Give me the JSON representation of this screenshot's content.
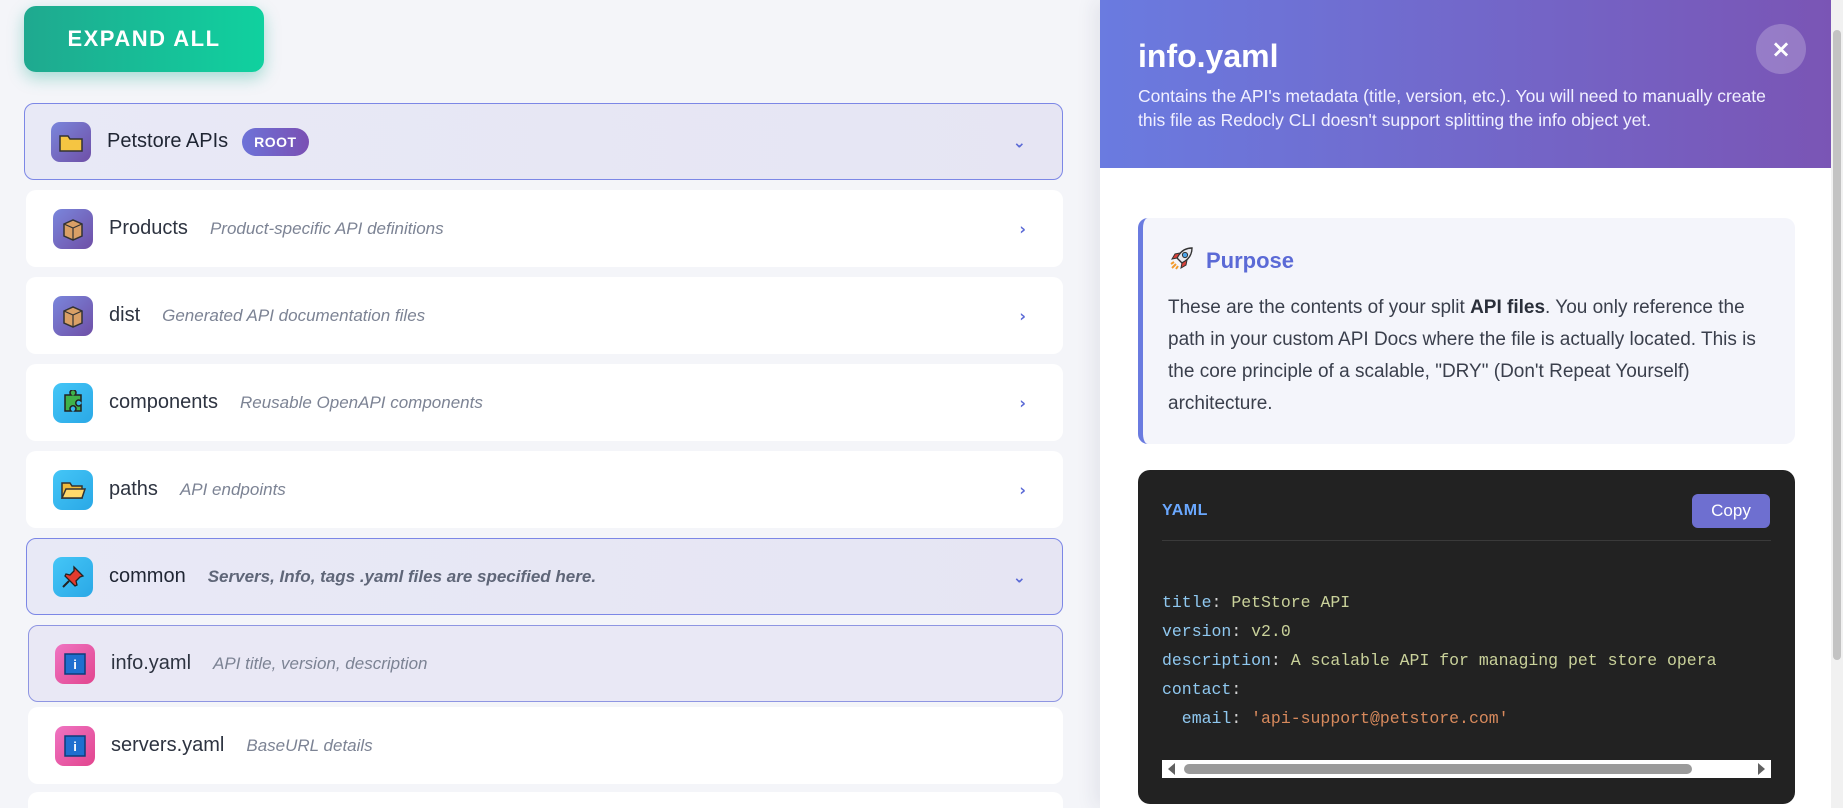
{
  "toolbar": {
    "expand_all": "EXPAND ALL"
  },
  "tree": {
    "root": {
      "label": "Petstore APIs",
      "badge": "ROOT",
      "icon": "folder-icon",
      "chevron": "⌄"
    },
    "items": [
      {
        "label": "Products",
        "desc": "Product-specific API definitions",
        "icon": "box-icon",
        "chevron": "›"
      },
      {
        "label": "dist",
        "desc": "Generated API documentation files",
        "icon": "box-icon",
        "chevron": "›"
      },
      {
        "label": "components",
        "desc": "Reusable OpenAPI components",
        "icon": "puzzle-icon",
        "chevron": "›"
      },
      {
        "label": "paths",
        "desc": "API endpoints",
        "icon": "open-folder-icon",
        "chevron": "›"
      }
    ],
    "common": {
      "label": "common",
      "desc": "Servers, Info, tags .yaml files are specified here.",
      "icon": "pushpin-icon",
      "chevron": "⌄"
    },
    "files": [
      {
        "label": "info.yaml",
        "desc": "API title, version, description",
        "icon": "info-icon"
      },
      {
        "label": "servers.yaml",
        "desc": "BaseURL details",
        "icon": "info-icon"
      }
    ]
  },
  "panel": {
    "title": "info.yaml",
    "subtitle": "Contains the API's metadata (title, version, etc.). You will need to manually create this file as Redocly CLI doesn't support splitting the info object yet.",
    "close": "×",
    "purpose": {
      "title": "Purpose",
      "icon": "rocket-icon",
      "text_before": "These are the contents of your split ",
      "text_bold": "API files",
      "text_after": ". You only reference the path in your custom API Docs where the file is actually located. This is the core principle of a scalable, \"DRY\" (Don't Repeat Yourself) architecture."
    },
    "code": {
      "language": "YAML",
      "copy_label": "Copy",
      "lines": [
        {
          "key": "title",
          "value": "PetStore API"
        },
        {
          "key": "version",
          "value": "v2.0"
        },
        {
          "key": "description",
          "value": "A scalable API for managing pet store opera"
        },
        {
          "key": "contact",
          "value": ""
        },
        {
          "key": "  email",
          "value": "'api-support@petstore.com'"
        }
      ]
    }
  },
  "colors": {
    "accent": "#6a7be0",
    "expand_button": "#10d19f",
    "panel_header": "#7a55b5"
  }
}
